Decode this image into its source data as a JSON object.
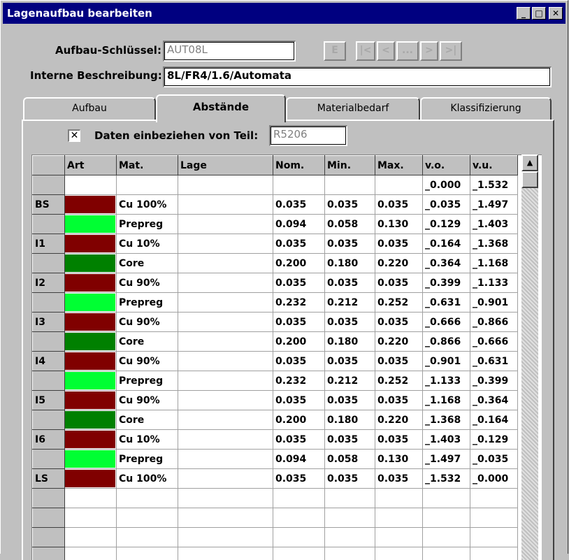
{
  "window": {
    "title": "Lagenaufbau bearbeiten",
    "minimize": "_",
    "maximize": "□",
    "close": "✕"
  },
  "form": {
    "key_label": "Aufbau-Schlüssel:",
    "key_value": "AUT08L",
    "desc_label": "Interne Beschreibung:",
    "desc_value": "8L/FR4/1.6/Automata"
  },
  "nav": {
    "edit": "E",
    "first": "|<",
    "prev": "<",
    "more": "...",
    "next": ">",
    "last": ">|"
  },
  "tabs": [
    "Aufbau",
    "Abstände",
    "Materialbedarf",
    "Klassifizierung"
  ],
  "active_tab": 1,
  "include": {
    "check_mark": "✕",
    "label": "Daten einbeziehen von Teil:",
    "value": "R5206"
  },
  "grid": {
    "columns": [
      "",
      "Art",
      "Mat.",
      "Lage",
      "Nom.",
      "Min.",
      "Max.",
      "v.o.",
      "v.u."
    ],
    "rows": [
      {
        "hdr": "",
        "color": "",
        "mat": "",
        "lage": "",
        "nom": "",
        "min": "",
        "max": "",
        "vo": "_0.000",
        "vu": "_1.532"
      },
      {
        "hdr": "BS",
        "color": "#800000",
        "mat": "Cu 100%",
        "lage": "",
        "nom": "0.035",
        "min": "0.035",
        "max": "0.035",
        "vo": "_0.035",
        "vu": "_1.497"
      },
      {
        "hdr": "",
        "color": "#00ff33",
        "mat": "Prepreg",
        "lage": "",
        "nom": "0.094",
        "min": "0.058",
        "max": "0.130",
        "vo": "_0.129",
        "vu": "_1.403"
      },
      {
        "hdr": "I1",
        "color": "#800000",
        "mat": "Cu 10%",
        "lage": "",
        "nom": "0.035",
        "min": "0.035",
        "max": "0.035",
        "vo": "_0.164",
        "vu": "_1.368"
      },
      {
        "hdr": "",
        "color": "#008000",
        "mat": "Core",
        "lage": "",
        "nom": "0.200",
        "min": "0.180",
        "max": "0.220",
        "vo": "_0.364",
        "vu": "_1.168"
      },
      {
        "hdr": "I2",
        "color": "#800000",
        "mat": "Cu 90%",
        "lage": "",
        "nom": "0.035",
        "min": "0.035",
        "max": "0.035",
        "vo": "_0.399",
        "vu": "_1.133"
      },
      {
        "hdr": "",
        "color": "#00ff33",
        "mat": "Prepreg",
        "lage": "",
        "nom": "0.232",
        "min": "0.212",
        "max": "0.252",
        "vo": "_0.631",
        "vu": "_0.901"
      },
      {
        "hdr": "I3",
        "color": "#800000",
        "mat": "Cu 90%",
        "lage": "",
        "nom": "0.035",
        "min": "0.035",
        "max": "0.035",
        "vo": "_0.666",
        "vu": "_0.866"
      },
      {
        "hdr": "",
        "color": "#008000",
        "mat": "Core",
        "lage": "",
        "nom": "0.200",
        "min": "0.180",
        "max": "0.220",
        "vo": "_0.866",
        "vu": "_0.666"
      },
      {
        "hdr": "I4",
        "color": "#800000",
        "mat": "Cu 90%",
        "lage": "",
        "nom": "0.035",
        "min": "0.035",
        "max": "0.035",
        "vo": "_0.901",
        "vu": "_0.631"
      },
      {
        "hdr": "",
        "color": "#00ff33",
        "mat": "Prepreg",
        "lage": "",
        "nom": "0.232",
        "min": "0.212",
        "max": "0.252",
        "vo": "_1.133",
        "vu": "_0.399"
      },
      {
        "hdr": "I5",
        "color": "#800000",
        "mat": "Cu 90%",
        "lage": "",
        "nom": "0.035",
        "min": "0.035",
        "max": "0.035",
        "vo": "_1.168",
        "vu": "_0.364"
      },
      {
        "hdr": "",
        "color": "#008000",
        "mat": "Core",
        "lage": "",
        "nom": "0.200",
        "min": "0.180",
        "max": "0.220",
        "vo": "_1.368",
        "vu": "_0.164"
      },
      {
        "hdr": "I6",
        "color": "#800000",
        "mat": "Cu 10%",
        "lage": "",
        "nom": "0.035",
        "min": "0.035",
        "max": "0.035",
        "vo": "_1.403",
        "vu": "_0.129"
      },
      {
        "hdr": "",
        "color": "#00ff33",
        "mat": "Prepreg",
        "lage": "",
        "nom": "0.094",
        "min": "0.058",
        "max": "0.130",
        "vo": "_1.497",
        "vu": "_0.035"
      },
      {
        "hdr": "LS",
        "color": "#800000",
        "mat": "Cu 100%",
        "lage": "",
        "nom": "0.035",
        "min": "0.035",
        "max": "0.035",
        "vo": "_1.532",
        "vu": "_0.000"
      },
      {
        "hdr": "",
        "color": "",
        "mat": "",
        "lage": "",
        "nom": "",
        "min": "",
        "max": "",
        "vo": "",
        "vu": ""
      },
      {
        "hdr": "",
        "color": "",
        "mat": "",
        "lage": "",
        "nom": "",
        "min": "",
        "max": "",
        "vo": "",
        "vu": ""
      },
      {
        "hdr": "",
        "color": "",
        "mat": "",
        "lage": "",
        "nom": "",
        "min": "",
        "max": "",
        "vo": "",
        "vu": ""
      },
      {
        "hdr": "",
        "color": "",
        "mat": "",
        "lage": "",
        "nom": "",
        "min": "",
        "max": "",
        "vo": "",
        "vu": ""
      }
    ]
  },
  "scrollbar": {
    "up": "▲"
  }
}
